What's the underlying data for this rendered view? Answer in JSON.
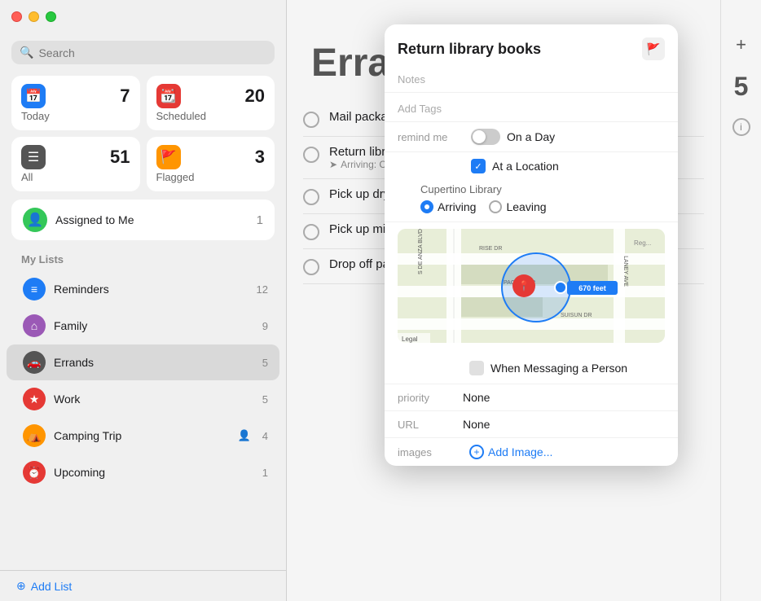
{
  "app": {
    "title": "Reminders"
  },
  "sidebar": {
    "search_placeholder": "Search",
    "smart_lists": [
      {
        "id": "today",
        "label": "Today",
        "count": 7,
        "icon_color": "#1e7cf5",
        "icon": "📅"
      },
      {
        "id": "scheduled",
        "label": "Scheduled",
        "count": 20,
        "icon_color": "#e53935",
        "icon": "📆"
      },
      {
        "id": "all",
        "label": "All",
        "count": 51,
        "icon_color": "#555555",
        "icon": "☰"
      },
      {
        "id": "flagged",
        "label": "Flagged",
        "count": 3,
        "icon_color": "#ff9500",
        "icon": "🚩"
      }
    ],
    "assigned_to_me": {
      "label": "Assigned to Me",
      "count": 1,
      "icon_color": "#34c759"
    },
    "my_lists_header": "My Lists",
    "lists": [
      {
        "id": "reminders",
        "label": "Reminders",
        "count": 12,
        "icon_color": "#1e7cf5",
        "icon": "≡"
      },
      {
        "id": "family",
        "label": "Family",
        "count": 9,
        "icon_color": "#9b59b6",
        "icon": "⌂"
      },
      {
        "id": "errands",
        "label": "Errands",
        "count": 5,
        "icon_color": "#555",
        "icon": "🚗",
        "active": true
      },
      {
        "id": "work",
        "label": "Work",
        "count": 5,
        "icon_color": "#e53935",
        "icon": "★"
      },
      {
        "id": "camping-trip",
        "label": "Camping Trip",
        "count": 4,
        "icon_color": "#ff9500",
        "icon": "⛺",
        "shared": true
      },
      {
        "id": "upcoming",
        "label": "Upcoming",
        "count": 1,
        "icon_color": "#e53935",
        "icon": "⏰"
      }
    ],
    "add_list_label": "Add List"
  },
  "main": {
    "list_title": "Errands",
    "tasks": [
      {
        "id": 1,
        "text": "Mail package",
        "sub": ""
      },
      {
        "id": 2,
        "text": "Return library books",
        "sub": "Arriving: C...",
        "has_location": true
      },
      {
        "id": 3,
        "text": "Pick up dry c...",
        "sub": ""
      },
      {
        "id": 4,
        "text": "Pick up milk",
        "sub": ""
      },
      {
        "id": 5,
        "text": "Drop off pap...",
        "sub": ""
      }
    ],
    "count": 5
  },
  "popup": {
    "title": "Return library books",
    "flag_label": "🚩",
    "notes_placeholder": "Notes",
    "add_tags_placeholder": "Add Tags",
    "remind_me_label": "remind me",
    "on_a_day_label": "On a Day",
    "on_a_day_enabled": false,
    "at_location_label": "At a Location",
    "at_location_enabled": true,
    "location_name": "Cupertino Library",
    "arriving_label": "Arriving",
    "leaving_label": "Leaving",
    "arriving_selected": true,
    "map_distance": "670 feet",
    "when_messaging_label": "When Messaging a Person",
    "when_messaging_enabled": false,
    "priority_label": "priority",
    "priority_value": "None",
    "url_label": "URL",
    "url_value": "None",
    "images_label": "images",
    "add_image_label": "Add Image..."
  },
  "map": {
    "streets": [
      "S DE ANZA BLVD",
      "RISE DR",
      "PACIFIC DR",
      "SUISUN DR",
      "LANEY AVE"
    ],
    "legal_text": "Legal"
  }
}
